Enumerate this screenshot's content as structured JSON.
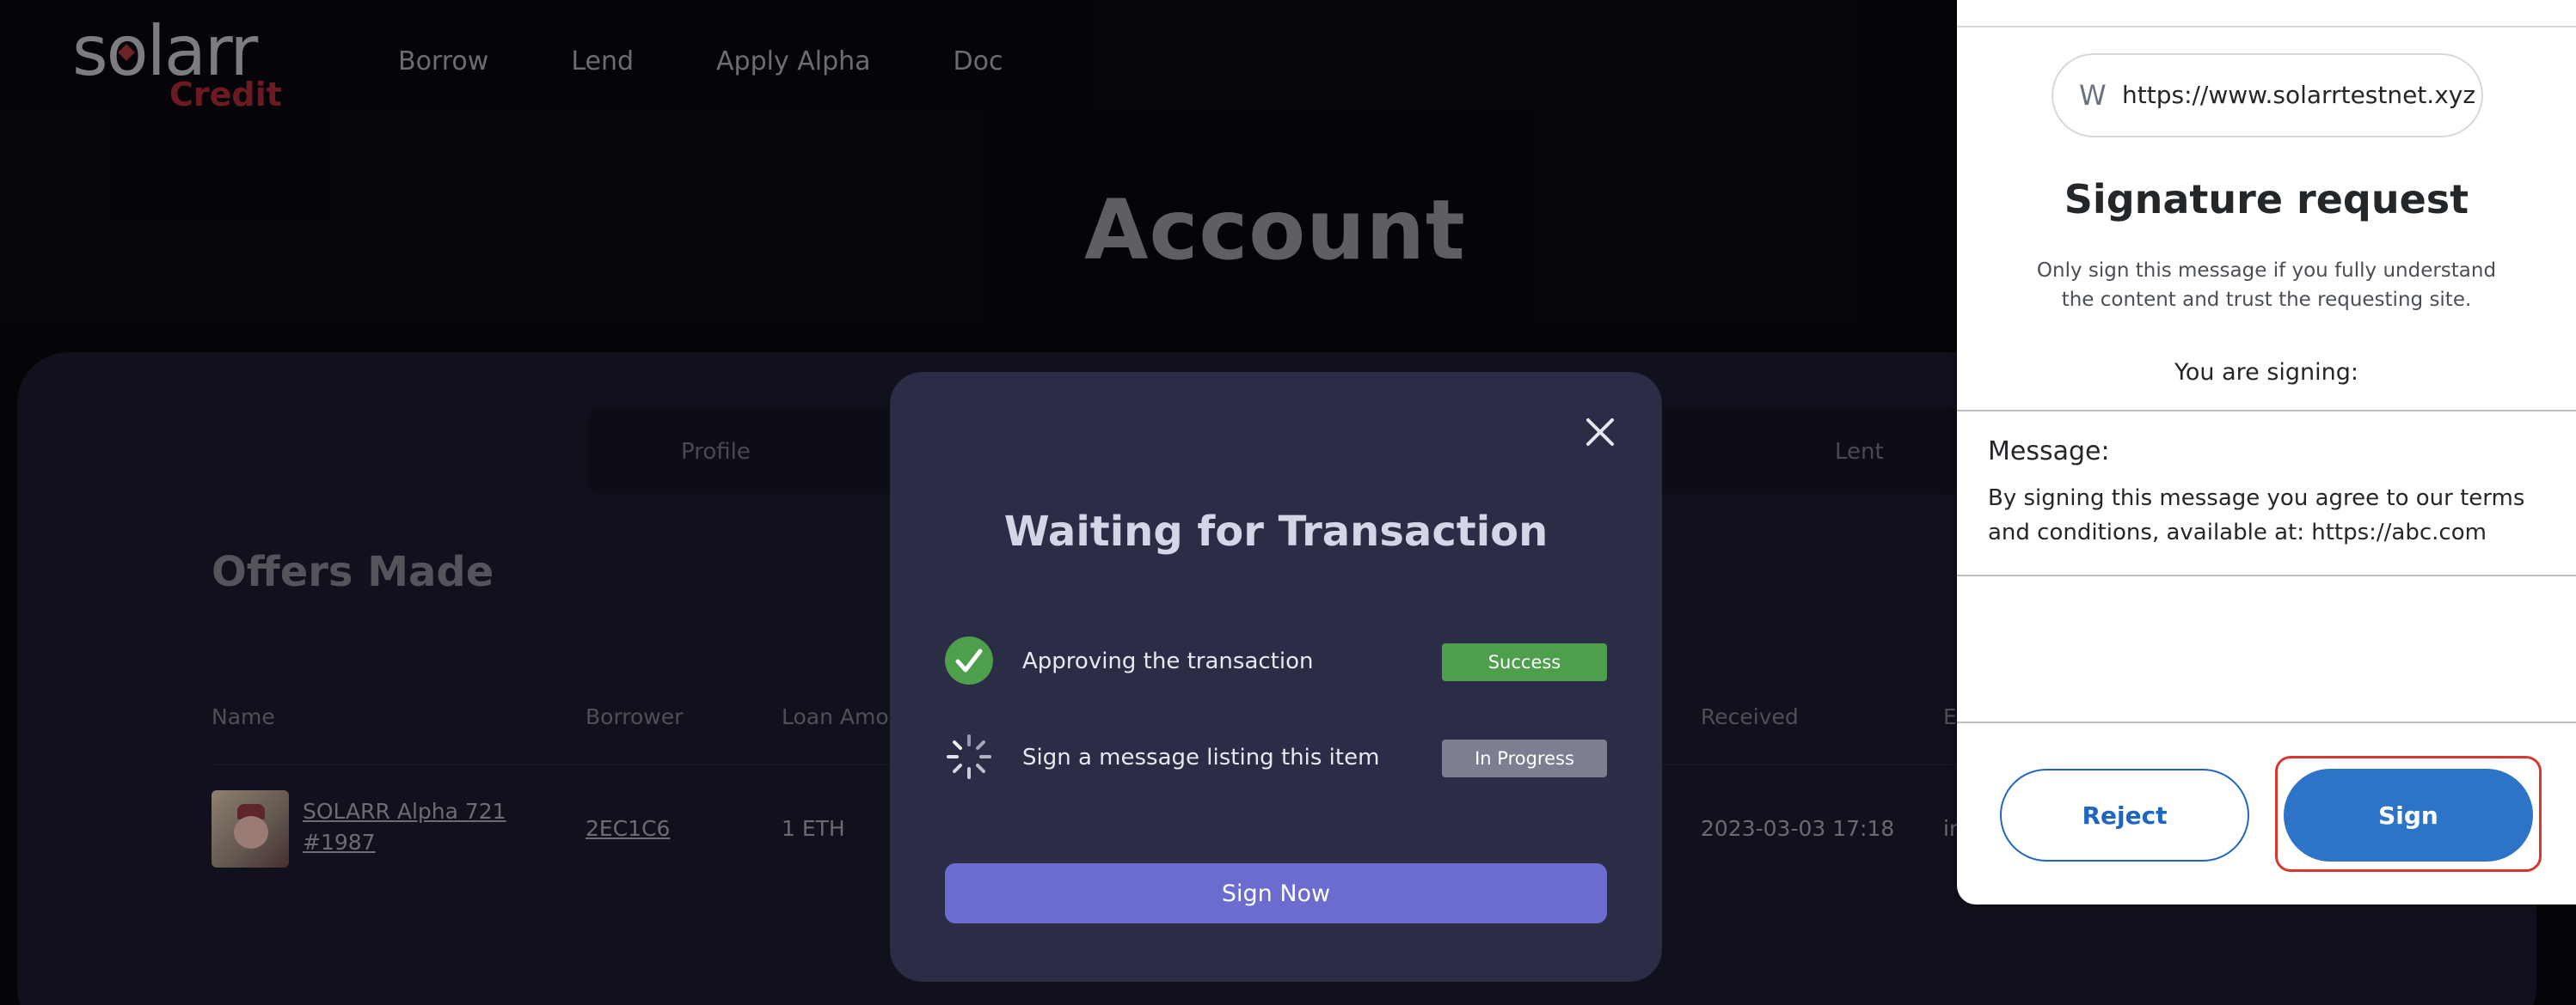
{
  "brand": {
    "name": "solarr",
    "sub": "Credit"
  },
  "nav": [
    "Borrow",
    "Lend",
    "Apply Alpha",
    "Doc"
  ],
  "page": {
    "title": "Account",
    "section_title": "Offers Made"
  },
  "tabs": [
    "Profile",
    "Lent"
  ],
  "table": {
    "headers": [
      "Name",
      "Borrower",
      "Loan Amou",
      "Received",
      "E"
    ],
    "rows": [
      {
        "name_line1": "SOLARR Alpha 721",
        "name_line2": "#1987",
        "borrower": "2EC1C6",
        "loan_amount": "1 ETH",
        "received": "2023-03-03 17:18",
        "extra": "in"
      }
    ]
  },
  "modal": {
    "title": "Waiting for Transaction",
    "steps": [
      {
        "label": "Approving the transaction",
        "status": "Success",
        "icon": "check-circle-icon"
      },
      {
        "label": "Sign a message listing this item",
        "status": "In Progress",
        "icon": "spinner-icon"
      }
    ],
    "button": "Sign Now"
  },
  "wallet": {
    "origin_avatar": "W",
    "origin_url": "https://www.solarrtestnet.xyz",
    "title": "Signature request",
    "warning": "Only sign this message if you fully understand the content and trust the requesting site.",
    "signing_label": "You are signing:",
    "message_label": "Message:",
    "message_body": "By signing this message you agree to our terms and conditions, available at: https://abc.com",
    "reject": "Reject",
    "sign": "Sign"
  },
  "colors": {
    "success": "#4e9f4b",
    "in_progress": "#7d7f91",
    "primary_purple": "#6b6bd0",
    "wallet_blue": "#2d74c9",
    "highlight_red": "#d7382d"
  }
}
